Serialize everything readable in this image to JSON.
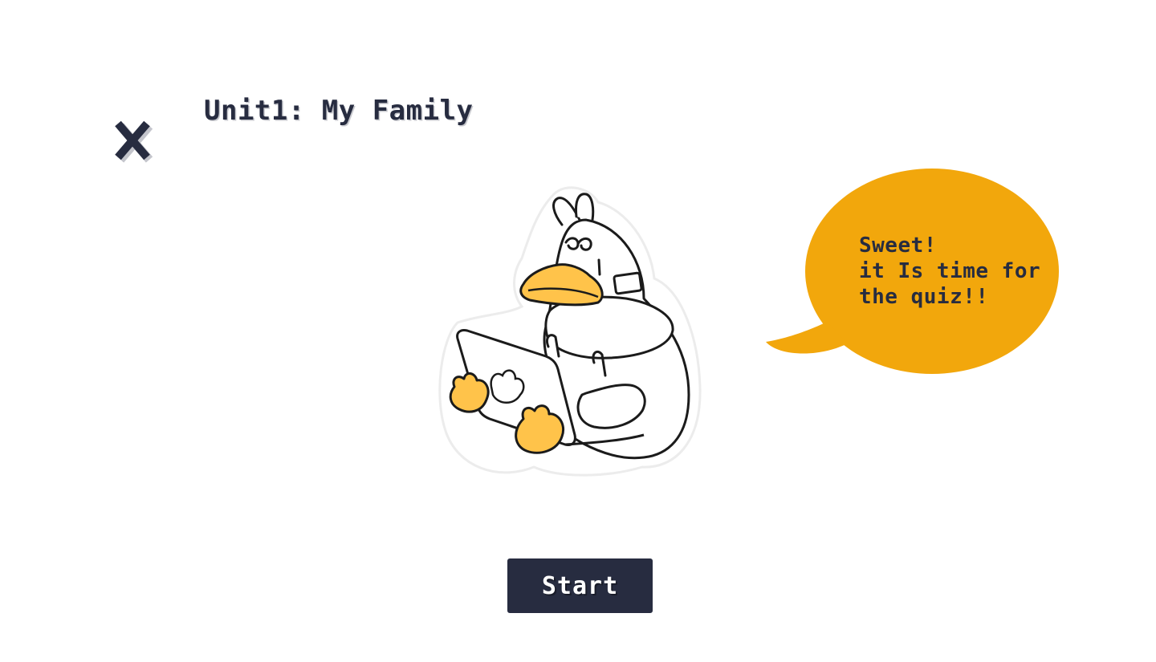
{
  "header": {
    "title": "Unit1: My Family",
    "close_icon": "close-icon"
  },
  "mascot": {
    "icon": "duck-with-laptop-illustration"
  },
  "speech_bubble": {
    "lines": [
      "Sweet!",
      "it Is time for",
      "the quiz!!"
    ],
    "color": "#f2a70c"
  },
  "actions": {
    "start_label": "Start"
  },
  "colors": {
    "primary_dark": "#272c40",
    "accent": "#f2a70c",
    "duck_yellow": "#ffc34a"
  }
}
